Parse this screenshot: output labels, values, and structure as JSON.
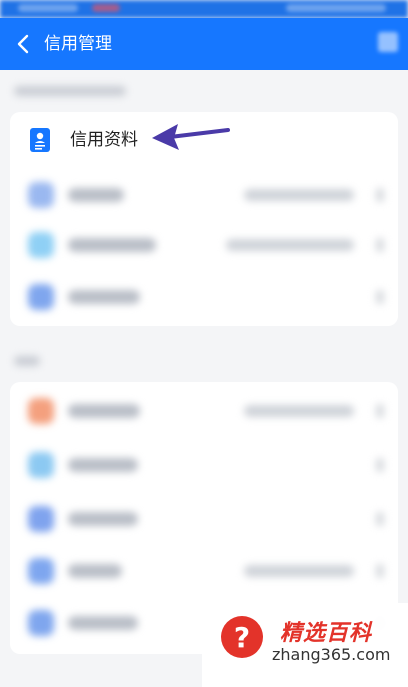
{
  "header": {
    "title": "信用管理",
    "accent": "#1677ff"
  },
  "highlight": {
    "label": "信用资料",
    "icon": "contact-card-icon",
    "arrow_color": "#4a3aa8"
  },
  "blurred_rows_section1": [
    {
      "icon_color": "#9ab8f0"
    },
    {
      "icon_color": "#8fd0f5"
    },
    {
      "icon_color": "#7fa6ee"
    }
  ],
  "blurred_rows_section2": [
    {
      "icon_color": "#f4a07e"
    },
    {
      "icon_color": "#8cc9f2"
    },
    {
      "icon_color": "#7fa3ee"
    },
    {
      "icon_color": "#7ea6ef"
    },
    {
      "icon_color": "#7fa6ee"
    }
  ],
  "watermark": {
    "name": "精选百科",
    "url": "zhang365.com",
    "color": "#e3332a"
  }
}
